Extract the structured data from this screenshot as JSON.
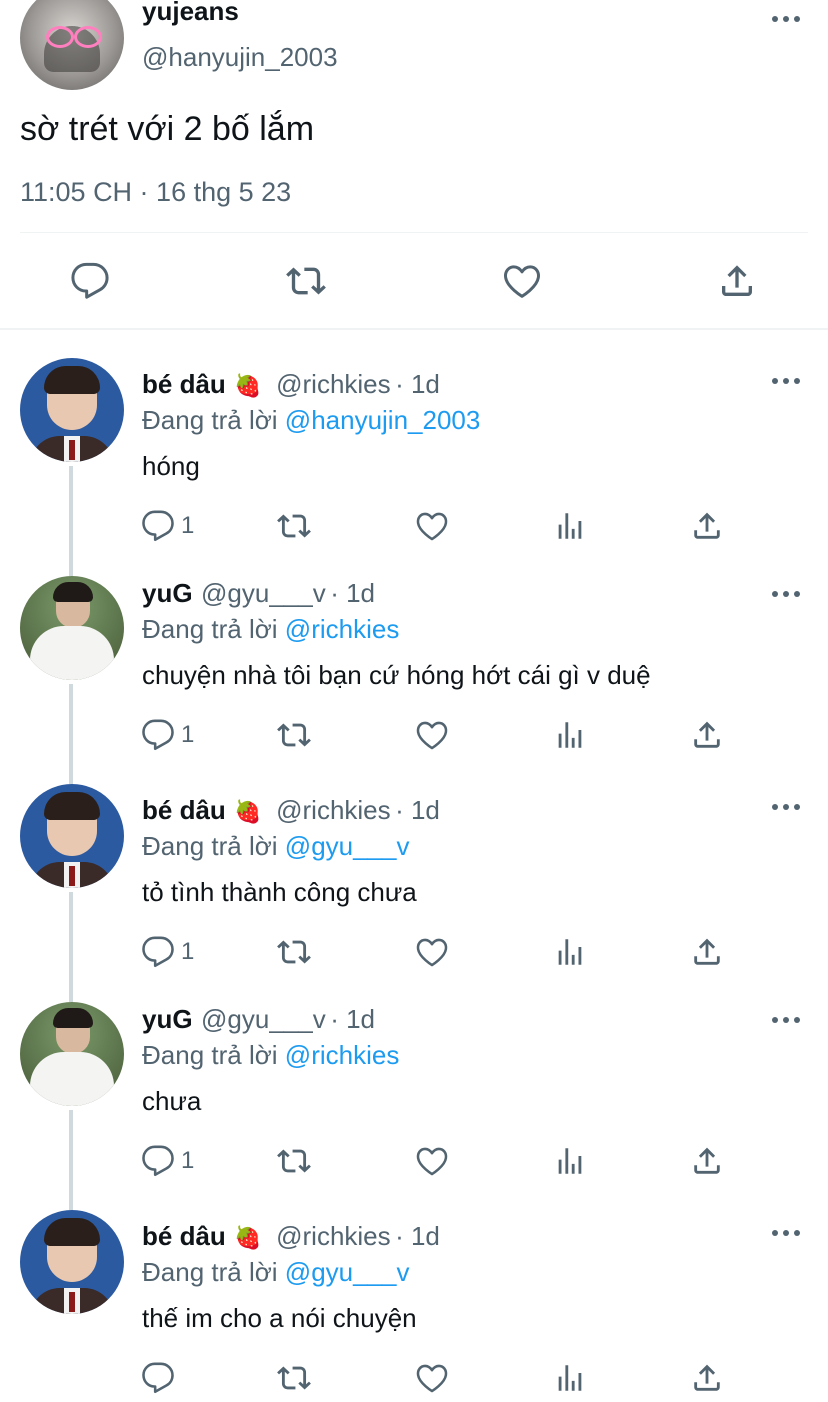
{
  "main_tweet": {
    "display_name": "yujeans",
    "handle": "@hanyujin_2003",
    "text": "sờ trét với 2 bố lắm",
    "timestamp": "11:05 CH · 16 thg 5 23"
  },
  "replies": [
    {
      "display_name": "bé dâu",
      "emoji": "🍓",
      "handle": "@richkies",
      "time_ago": "· 1d",
      "replying_prefix": "Đang trả lời",
      "replying_to": "@hanyujin_2003",
      "text": "hóng",
      "reply_count": "1"
    },
    {
      "display_name": "yuG",
      "handle": "@gyu___v",
      "time_ago": "· 1d",
      "replying_prefix": "Đang trả lời",
      "replying_to": "@richkies",
      "text": "chuyện nhà tôi bạn cứ hóng hớt cái gì v duệ",
      "reply_count": "1"
    },
    {
      "display_name": "bé dâu",
      "emoji": "🍓",
      "handle": "@richkies",
      "time_ago": "· 1d",
      "replying_prefix": "Đang trả lời",
      "replying_to": "@gyu___v",
      "text": "tỏ tình thành công chưa",
      "reply_count": "1"
    },
    {
      "display_name": "yuG",
      "handle": "@gyu___v",
      "time_ago": "· 1d",
      "replying_prefix": "Đang trả lời",
      "replying_to": "@richkies",
      "text": "chưa",
      "reply_count": "1"
    },
    {
      "display_name": "bé dâu",
      "emoji": "🍓",
      "handle": "@richkies",
      "time_ago": "· 1d",
      "replying_prefix": "Đang trả lời",
      "replying_to": "@gyu___v",
      "text": "thế im cho a nói chuyện",
      "reply_count": ""
    }
  ],
  "icons": [
    "reply-icon",
    "retweet-icon",
    "like-icon",
    "views-icon",
    "share-icon",
    "more-icon",
    "strawberry-emoji"
  ],
  "colors": {
    "text": "#0f1419",
    "muted": "#536471",
    "link": "#1d9bf0",
    "divider": "#eff3f4"
  }
}
